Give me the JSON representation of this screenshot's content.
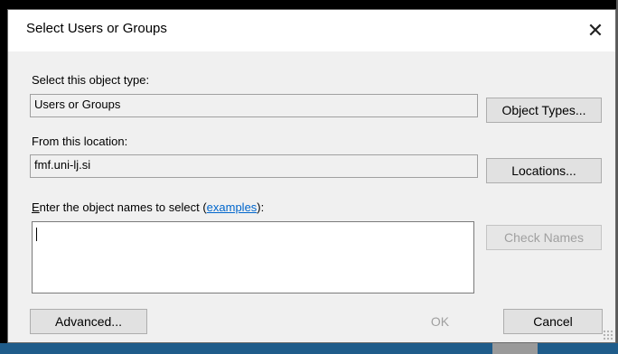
{
  "window": {
    "title": "Select Users or Groups"
  },
  "object_type": {
    "label": "Select this object type:",
    "value": "Users or Groups",
    "button": "Object Types..."
  },
  "location": {
    "label": "From this location:",
    "value": "fmf.uni-lj.si",
    "button": "Locations..."
  },
  "names": {
    "label_accel": "E",
    "label_rest": "nter the object names to select (",
    "link": "examples",
    "label_end": "):",
    "value": "",
    "check_button": "Check Names"
  },
  "footer": {
    "advanced": "Advanced...",
    "ok": "OK",
    "cancel": "Cancel"
  },
  "colors": {
    "link": "#0066cc",
    "disabled_text": "#a0a0a0",
    "accent_strip": "#1f5c8a"
  }
}
